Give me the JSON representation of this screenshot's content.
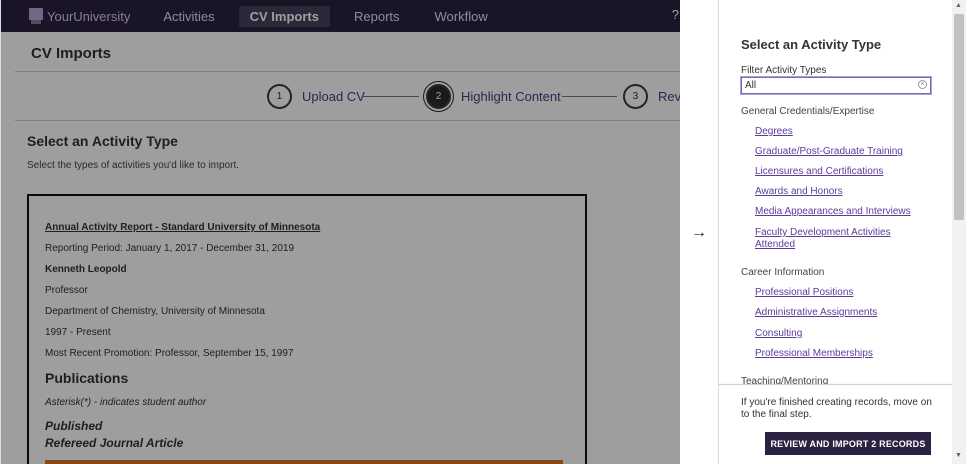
{
  "nav": {
    "logo_text": "YourUniversity",
    "items": [
      "Activities",
      "CV Imports",
      "Reports",
      "Workflow"
    ],
    "help": "?"
  },
  "page": {
    "title": "CV Imports",
    "steps": [
      {
        "number": "1",
        "label": "Upload CV"
      },
      {
        "number": "2",
        "label": "Highlight Content"
      },
      {
        "number": "3",
        "label": "Review"
      }
    ],
    "section_title": "Select an Activity Type",
    "section_subtitle": "Select the types of activities you'd like to import."
  },
  "cv": {
    "lines": [
      "Annual Activity Report - Standard University of Minnesota",
      "Reporting Period: January 1, 2017 - December 31, 2019",
      "Kenneth Leopold",
      "Professor",
      "Department of Chemistry, University of Minnesota",
      "1997 - Present",
      "Most Recent Promotion: Professor, September 15, 1997"
    ],
    "publications_heading": "Publications",
    "asterisk_note": "Asterisk(*) - indicates student author",
    "published_heading": "Published",
    "refereed_heading": "Refereed Journal Article"
  },
  "arrow": "→",
  "panel": {
    "title": "Select an Activity Type",
    "filter_label": "Filter Activity Types",
    "filter_value": "All",
    "groups": [
      {
        "title": "General Credentials/Expertise",
        "items": [
          "Degrees",
          "Graduate/Post-Graduate Training",
          "Licensures and Certifications",
          "Awards and Honors",
          "Media Appearances and Interviews",
          "Faculty Development Activities Attended"
        ]
      },
      {
        "title": "Career Information",
        "items": [
          "Professional Positions",
          "Administrative Assignments",
          "Consulting",
          "Professional Memberships"
        ]
      },
      {
        "title": "Teaching/Mentoring",
        "items": []
      }
    ],
    "footer_text": "If you're finished creating records, move on to the final step.",
    "button_label": "REVIEW AND IMPORT 2 RECORDS"
  },
  "colors": {
    "nav_bg": "#2b2140",
    "link": "#5b3d99",
    "highlight": "#d97a22",
    "button_bg": "#2b2140"
  }
}
